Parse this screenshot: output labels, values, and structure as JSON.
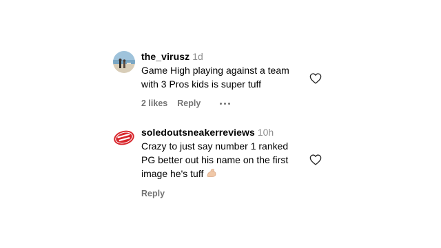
{
  "comments": [
    {
      "username": "the_virusz",
      "time": "1d",
      "lines": [
        "Game High playing against a team",
        "with 3 Pros kids is super tuff"
      ],
      "likes": "2 likes",
      "reply": "Reply",
      "avatar_icon": "beach-photo-avatar",
      "has_more_menu": true
    },
    {
      "username": "soledoutsneakerreviews",
      "time": "10h",
      "lines": [
        "Crazy to just say number 1 ranked",
        "PG better out his name on the first",
        "image he's tuff"
      ],
      "emoji": "flexed-biceps-emoji",
      "reply": "Reply",
      "avatar_icon": "sold-out-badge-avatar",
      "has_more_menu": false
    }
  ],
  "colors": {
    "text": "#000000",
    "muted": "#8e8e8e",
    "action": "#737373",
    "avatar2_red": "#d8262c"
  }
}
